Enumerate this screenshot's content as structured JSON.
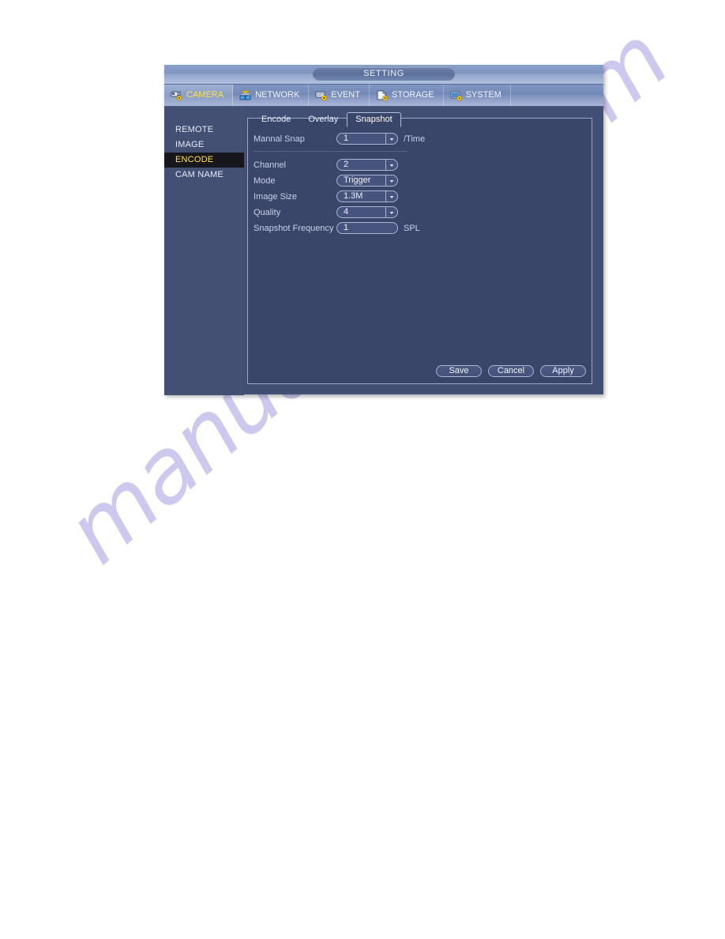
{
  "window": {
    "title": "SETTING"
  },
  "main_nav": {
    "tabs": [
      {
        "label": "CAMERA",
        "icon": "camera-gear-icon",
        "active": true
      },
      {
        "label": "NETWORK",
        "icon": "network-gear-icon",
        "active": false
      },
      {
        "label": "EVENT",
        "icon": "event-gear-icon",
        "active": false
      },
      {
        "label": "STORAGE",
        "icon": "storage-gear-icon",
        "active": false
      },
      {
        "label": "SYSTEM",
        "icon": "system-gear-icon",
        "active": false
      }
    ]
  },
  "sidebar": {
    "items": [
      {
        "label": "REMOTE",
        "active": false
      },
      {
        "label": "IMAGE",
        "active": false
      },
      {
        "label": "ENCODE",
        "active": true
      },
      {
        "label": "CAM NAME",
        "active": false
      }
    ]
  },
  "sub_tabs": [
    {
      "label": "Encode",
      "active": false
    },
    {
      "label": "Overlay",
      "active": false
    },
    {
      "label": "Snapshot",
      "active": true
    }
  ],
  "form": {
    "manual_snap": {
      "label": "Mannal Snap",
      "value": "1",
      "suffix": "/Time"
    },
    "channel": {
      "label": "Channel",
      "value": "2"
    },
    "mode": {
      "label": "Mode",
      "value": "Trigger"
    },
    "image_size": {
      "label": "Image Size",
      "value": "1.3M"
    },
    "quality": {
      "label": "Quality",
      "value": "4"
    },
    "snapshot_frequency": {
      "label": "Snapshot Frequency",
      "value": "1",
      "suffix": "SPL"
    }
  },
  "buttons": {
    "save": "Save",
    "cancel": "Cancel",
    "apply": "Apply"
  },
  "watermark": {
    "text": "manualshive.com"
  },
  "colors": {
    "window_bg": "#414f74",
    "panel_bg": "#3a456a",
    "accent_selected": "#ffe24a",
    "label_text": "#c8d2ea",
    "border": "#aab5d3",
    "watermark": "#b9b4e8"
  }
}
